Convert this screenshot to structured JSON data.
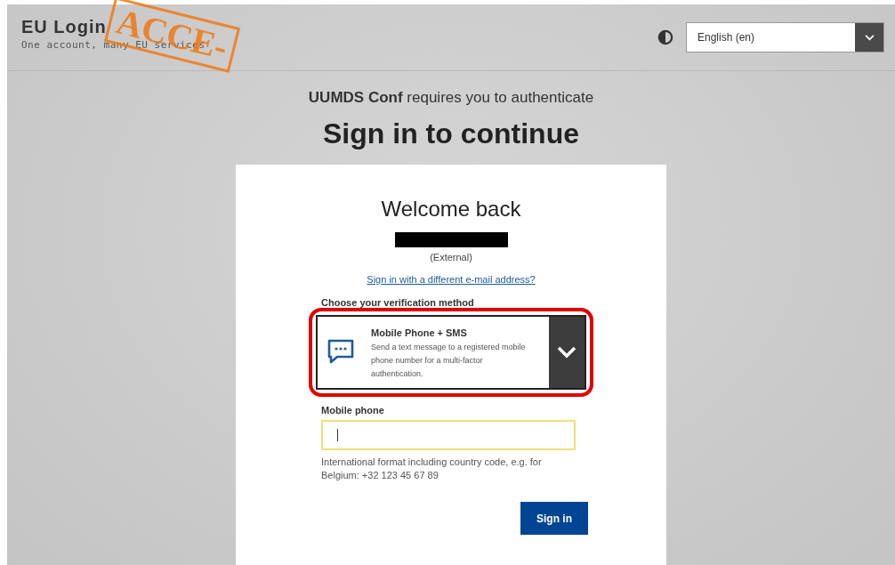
{
  "header": {
    "title": "EU Login",
    "tagline": "One account, many EU services",
    "stamp": "ACCE-"
  },
  "language_select": {
    "value": "English (en)"
  },
  "subtitle": "**UUMDS Conf** requires you to authenticate",
  "heading": "Sign in to continue",
  "card": {
    "greeting": "Welcome back",
    "account_type": "(External)",
    "switch_link": "Sign in with a different e-mail address?",
    "method_label": "Choose your verification method",
    "method": {
      "title": "Mobile Phone + SMS",
      "description": "Send a text message to a registered mobile phone number for a multi-factor authentication.",
      "highlighted": true
    },
    "phone_field": {
      "label": "Mobile phone",
      "focused": true,
      "hint": "International format including country code, e.g. for Belgium: +32 123 45 67 89"
    },
    "submit": "Sign in"
  }
}
